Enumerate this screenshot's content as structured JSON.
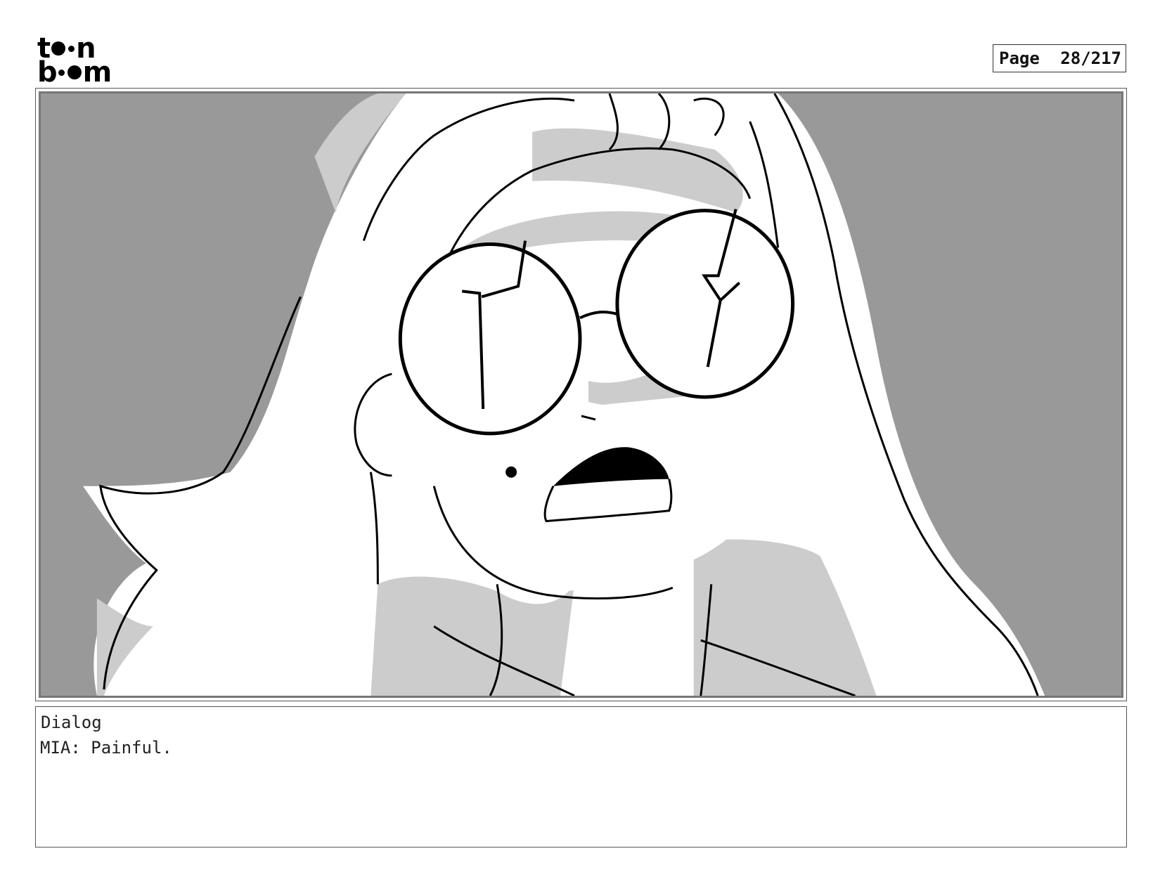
{
  "header": {
    "logo": {
      "row1_a": "t",
      "row1_b": "n",
      "row2_a": "b",
      "row2_b": "m",
      "alt": "toon boom"
    },
    "page": {
      "label": "Page",
      "value": "28/217"
    }
  },
  "panel": {
    "image": "storyboard-sketch-girl-with-round-glasses-shocked"
  },
  "dialog": {
    "label": "Dialog",
    "text": "MIA: Painful."
  },
  "colors": {
    "background": "#999999",
    "light_shade": "#cccccc",
    "ink": "#000000",
    "skin": "#ffffff"
  }
}
